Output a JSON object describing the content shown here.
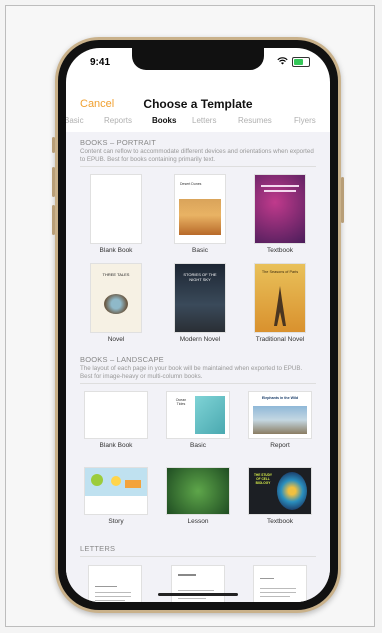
{
  "status": {
    "time": "9:41"
  },
  "header": {
    "cancel_label": "Cancel",
    "title": "Choose a Template"
  },
  "tabs": [
    {
      "label": "Basic"
    },
    {
      "label": "Reports"
    },
    {
      "label": "Books"
    },
    {
      "label": "Letters"
    },
    {
      "label": "Resumes"
    },
    {
      "label": "Flyers"
    }
  ],
  "sections": {
    "portrait": {
      "title": "BOOKS – PORTRAIT",
      "description": "Content can reflow to accommodate different devices and orientations when exported to EPUB. Best for books containing primarily text.",
      "items": [
        {
          "label": "Blank Book"
        },
        {
          "label": "Basic",
          "cover_text": "Desert Dunes"
        },
        {
          "label": "Textbook"
        },
        {
          "label": "Novel",
          "cover_text": "THREE TALES"
        },
        {
          "label": "Modern Novel",
          "cover_text": "STORIES OF THE NIGHT SKY"
        },
        {
          "label": "Traditional Novel",
          "cover_text": "The Seasons of Paris"
        }
      ]
    },
    "landscape": {
      "title": "BOOKS – LANDSCAPE",
      "description": "The layout of each page in your book will be maintained when exported to EPUB. Best for image-heavy or multi-column books.",
      "items": [
        {
          "label": "Blank Book"
        },
        {
          "label": "Basic",
          "cover_text": "Ocean Tides"
        },
        {
          "label": "Report",
          "cover_text": "Elephants in the Wild"
        },
        {
          "label": "Story"
        },
        {
          "label": "Lesson"
        },
        {
          "label": "Textbook",
          "cover_text": "THE STUDY OF CELL BIOLOGY"
        }
      ]
    },
    "letters": {
      "title": "LETTERS"
    }
  },
  "colors": {
    "accent": "#f0a030",
    "phone_gold": "#c9b18a"
  }
}
